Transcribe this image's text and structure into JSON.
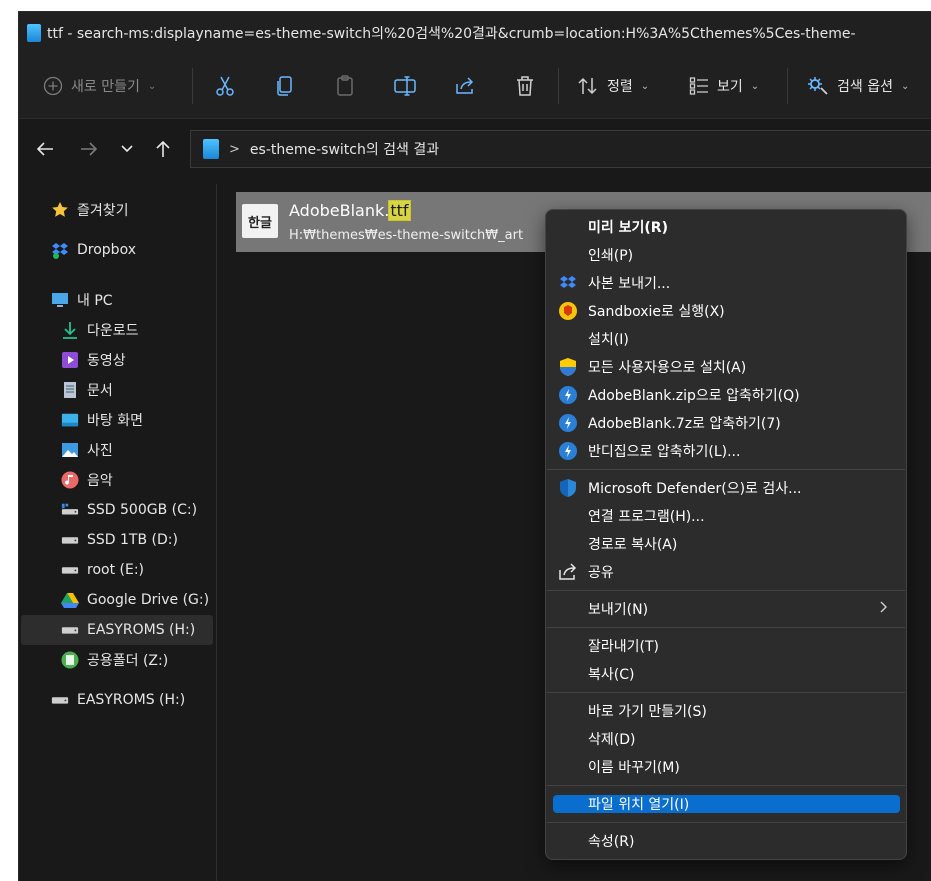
{
  "window": {
    "title": "ttf - search-ms:displayname=es-theme-switch의%20검색%20결과&crumb=location:H%3A%5Cthemes%5Ces-theme-"
  },
  "toolbar": {
    "new_label": "새로 만들기",
    "sort_label": "정렬",
    "view_label": "보기",
    "search_options_label": "검색 옵션"
  },
  "addressbar": {
    "separator": ">",
    "crumb": "es-theme-switch의 검색 결과"
  },
  "sidebar": {
    "items": [
      {
        "label": "즐겨찾기",
        "icon": "star-icon"
      },
      {
        "label": "Dropbox",
        "icon": "dropbox-icon"
      },
      {
        "label": "내 PC",
        "icon": "monitor-icon"
      },
      {
        "label": "다운로드",
        "icon": "download-icon"
      },
      {
        "label": "동영상",
        "icon": "video-icon"
      },
      {
        "label": "문서",
        "icon": "document-icon"
      },
      {
        "label": "바탕 화면",
        "icon": "desktop-icon"
      },
      {
        "label": "사진",
        "icon": "pictures-icon"
      },
      {
        "label": "음악",
        "icon": "music-icon"
      },
      {
        "label": "SSD 500GB (C:)",
        "icon": "system-drive-icon"
      },
      {
        "label": "SSD 1TB (D:)",
        "icon": "drive-icon"
      },
      {
        "label": "root (E:)",
        "icon": "drive-icon"
      },
      {
        "label": "Google Drive (G:)",
        "icon": "google-drive-icon"
      },
      {
        "label": "EASYROMS (H:)",
        "icon": "drive-icon"
      },
      {
        "label": "공용폴더 (Z:)",
        "icon": "network-folder-icon"
      },
      {
        "label": "EASYROMS (H:)",
        "icon": "drive-icon"
      }
    ]
  },
  "file": {
    "icon_text": "한글",
    "name_base": "AdobeBlank.",
    "name_match": "ttf",
    "path": "H:₩themes₩es-theme-switch₩_art"
  },
  "menu": {
    "items": [
      {
        "label": "미리 보기(R)",
        "icon": ""
      },
      {
        "label": "인쇄(P)",
        "icon": ""
      },
      {
        "label": "사본 보내기...",
        "icon": "dropbox-icon"
      },
      {
        "label": "Sandboxie로 실행(X)",
        "icon": "sandboxie-icon"
      },
      {
        "label": "설치(I)",
        "icon": ""
      },
      {
        "label": "모든 사용자용으로 설치(A)",
        "icon": "uac-shield-icon"
      },
      {
        "label": "AdobeBlank.zip으로 압축하기(Q)",
        "icon": "bandizip-icon"
      },
      {
        "label": "AdobeBlank.7z로 압축하기(7)",
        "icon": "bandizip-icon"
      },
      {
        "label": "반디집으로 압축하기(L)...",
        "icon": "bandizip-icon"
      },
      {
        "label": "Microsoft Defender(으)로 검사...",
        "icon": "defender-icon"
      },
      {
        "label": "연결 프로그램(H)...",
        "icon": ""
      },
      {
        "label": "경로로 복사(A)",
        "icon": ""
      },
      {
        "label": "공유",
        "icon": "share-icon"
      },
      {
        "label": "보내기(N)",
        "icon": ""
      },
      {
        "label": "잘라내기(T)",
        "icon": ""
      },
      {
        "label": "복사(C)",
        "icon": ""
      },
      {
        "label": "바로 가기 만들기(S)",
        "icon": ""
      },
      {
        "label": "삭제(D)",
        "icon": ""
      },
      {
        "label": "이름 바꾸기(M)",
        "icon": ""
      },
      {
        "label": "파일 위치 열기(I)",
        "icon": ""
      },
      {
        "label": "속성(R)",
        "icon": ""
      }
    ],
    "highlighted_index": 19
  },
  "colors": {
    "accent": "#0a6ecf",
    "background": "#191919",
    "menu_bg": "#2c2c2c",
    "selected_row": "#777777",
    "search_highlight": "#d8d640"
  }
}
